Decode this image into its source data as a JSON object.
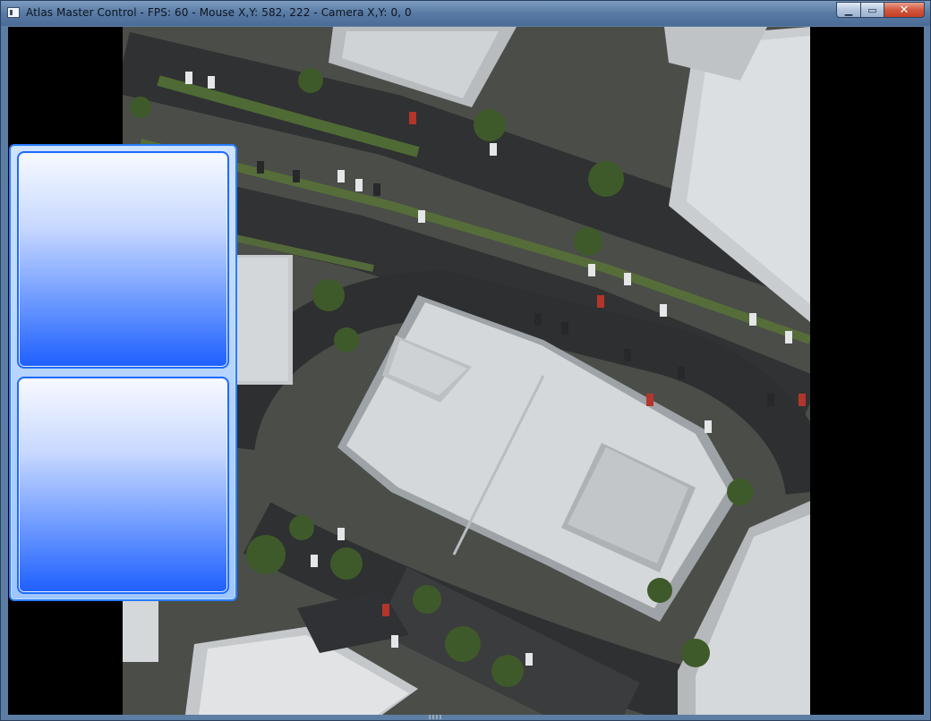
{
  "window": {
    "title": "Atlas Master Control - FPS: 60 - Mouse X,Y: 582, 222 - Camera X,Y: 0, 0",
    "controls": {
      "minimize_icon": "minimize-icon",
      "maximize_icon": "maximize-icon",
      "close_icon": "close-icon",
      "minimize_glyph": "▁",
      "maximize_glyph": "▭",
      "close_glyph": "✕"
    }
  },
  "map": {
    "content": "aerial-satellite-imagery"
  },
  "panel": {
    "slots": [
      {
        "id": "top"
      },
      {
        "id": "bottom"
      }
    ]
  },
  "colors": {
    "panel_border": "#2a7bff",
    "panel_fill_top": "#f7f9ff",
    "panel_fill_bottom": "#1e5fff",
    "titlebar": "#587aa3",
    "close_button": "#c33f25"
  }
}
